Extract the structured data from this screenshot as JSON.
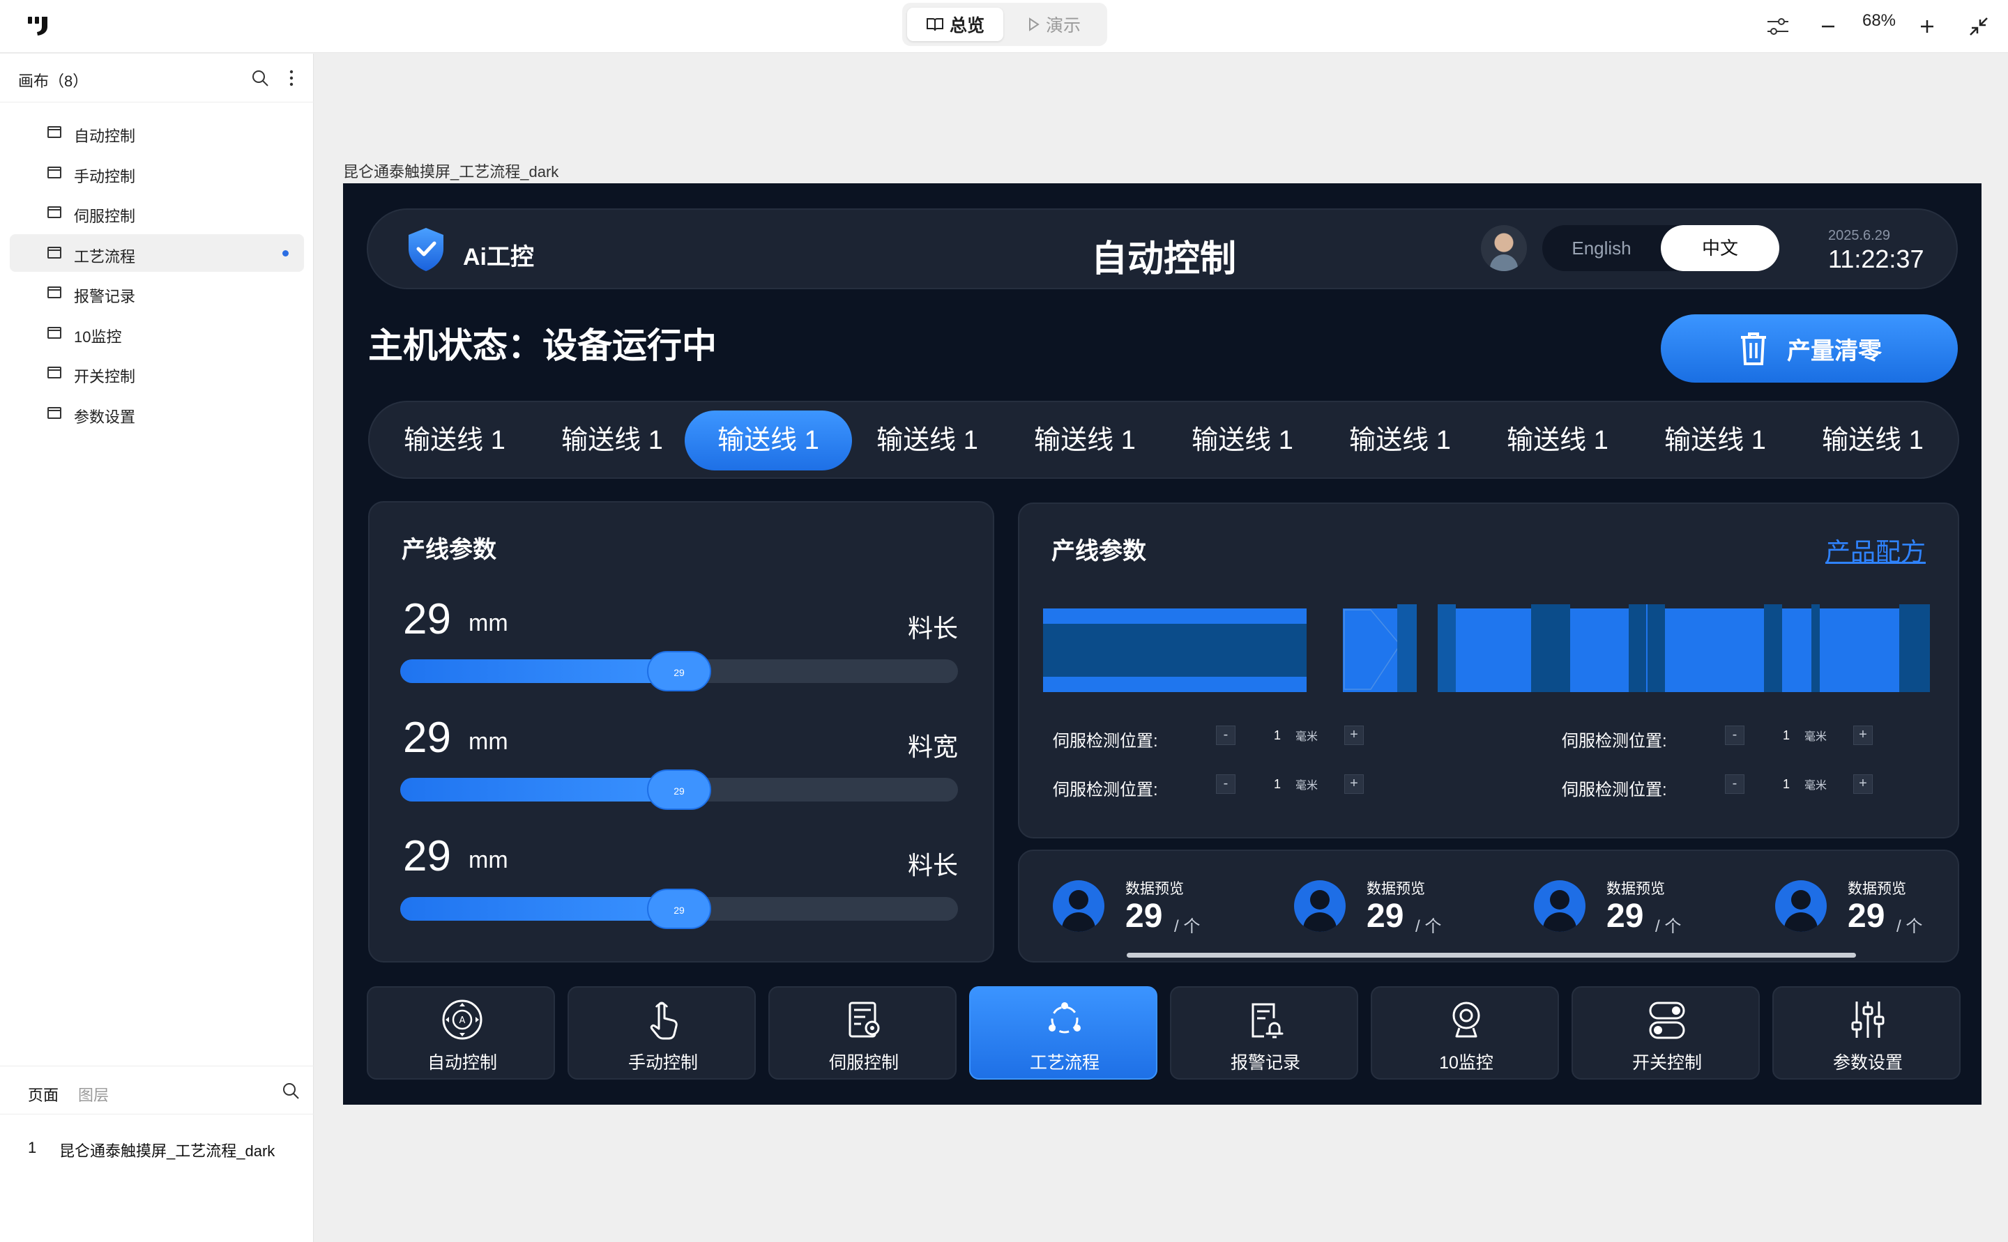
{
  "topbar": {
    "mode_overview": "总览",
    "mode_present": "演示",
    "zoom": "68%"
  },
  "sidebar": {
    "title": "画布（8）",
    "items": [
      {
        "label": "自动控制"
      },
      {
        "label": "手动控制"
      },
      {
        "label": "伺服控制"
      },
      {
        "label": "工艺流程"
      },
      {
        "label": "报警记录"
      },
      {
        "label": "10监控"
      },
      {
        "label": "开关控制"
      },
      {
        "label": "参数设置"
      }
    ],
    "selected_index": 3,
    "bottom_tabs": [
      "页面",
      "图层"
    ],
    "pages": [
      {
        "num": "1",
        "name": "昆仑通泰触摸屏_工艺流程_dark"
      }
    ]
  },
  "canvas": {
    "label": "昆仑通泰触摸屏_工艺流程_dark"
  },
  "screen": {
    "brand": "Ai工控",
    "title": "自动控制",
    "lang_en": "English",
    "lang_zh": "中文",
    "date": "2025.6.29",
    "time": "11:22:37",
    "status": "主机状态：设备运行中",
    "clear_button": "产量清零",
    "tabs": [
      "输送线 1",
      "输送线 1",
      "输送线 1",
      "输送线 1",
      "输送线 1",
      "输送线 1",
      "输送线 1",
      "输送线 1",
      "输送线 1",
      "输送线 1"
    ],
    "active_tab": 2,
    "params_panel": {
      "title": "产线参数",
      "rows": [
        {
          "value": "29",
          "unit": "mm",
          "name": "料长",
          "knob": "29",
          "fraction": 0.5
        },
        {
          "value": "29",
          "unit": "mm",
          "name": "料宽",
          "knob": "29",
          "fraction": 0.5
        },
        {
          "value": "29",
          "unit": "mm",
          "name": "料长",
          "knob": "29",
          "fraction": 0.5
        }
      ]
    },
    "line_panel": {
      "title": "产线参数",
      "link": "产品配方",
      "servo": [
        {
          "label": "伺服检测位置:",
          "value": "1",
          "unit": "毫米",
          "minus": "-",
          "plus": "+"
        },
        {
          "label": "伺服检测位置:",
          "value": "1",
          "unit": "毫米",
          "minus": "-",
          "plus": "+"
        },
        {
          "label": "伺服检测位置:",
          "value": "1",
          "unit": "毫米",
          "minus": "-",
          "plus": "+"
        },
        {
          "label": "伺服检测位置:",
          "value": "1",
          "unit": "毫米",
          "minus": "-",
          "plus": "+"
        }
      ]
    },
    "stats": [
      {
        "label": "数据预览",
        "value": "29",
        "unit": "/ 个"
      },
      {
        "label": "数据预览",
        "value": "29",
        "unit": "/ 个"
      },
      {
        "label": "数据预览",
        "value": "29",
        "unit": "/ 个"
      },
      {
        "label": "数据预览",
        "value": "29",
        "unit": "/ 个"
      }
    ],
    "functions": [
      {
        "label": "自动控制",
        "icon": "auto-control-icon"
      },
      {
        "label": "手动控制",
        "icon": "hand-pointer-icon"
      },
      {
        "label": "伺服控制",
        "icon": "servo-settings-icon"
      },
      {
        "label": "工艺流程",
        "icon": "process-flow-icon"
      },
      {
        "label": "报警记录",
        "icon": "alarm-record-icon"
      },
      {
        "label": "10监控",
        "icon": "webcam-icon"
      },
      {
        "label": "开关控制",
        "icon": "toggle-switch-icon"
      },
      {
        "label": "参数设置",
        "icon": "sliders-icon"
      }
    ],
    "active_function": 3,
    "colors": {
      "accent": "#2F83FF",
      "background": "#0B1322",
      "panel": "#1C2433"
    }
  }
}
